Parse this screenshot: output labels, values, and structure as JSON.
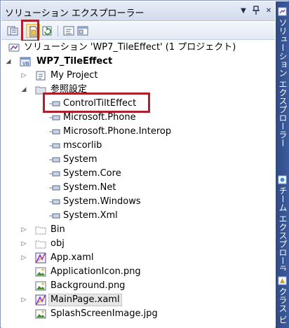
{
  "window": {
    "title": "ソリューション エクスプローラー"
  },
  "title_buttons": {
    "dropdown": "▼",
    "pin": "📌",
    "close": "✕"
  },
  "toolbar": {
    "buttons": [
      "properties-icon",
      "show-all-files-icon",
      "refresh-icon",
      "view-code-icon",
      "view-designer-icon"
    ]
  },
  "tree": {
    "solution": "ソリューション 'WP7_TileEffect' (1 プロジェクト)",
    "project": "WP7_TileEffect",
    "my_project": "My Project",
    "references": "参照設定",
    "ref_items": [
      "ControlTiltEffect",
      "Microsoft.Phone",
      "Microsoft.Phone.Interop",
      "mscorlib",
      "System",
      "System.Core",
      "System.Net",
      "System.Windows",
      "System.Xml"
    ],
    "folders": [
      "Bin",
      "obj"
    ],
    "files": [
      "App.xaml",
      "ApplicationIcon.png",
      "Background.png",
      "MainPage.xaml",
      "SplashScreenImage.jpg"
    ],
    "selected_item": "MainPage.xaml"
  },
  "side_tabs": [
    "ソリューション エクスプローラー",
    "チーム エクスプローラー",
    "クラス ビ"
  ],
  "colors": {
    "highlight": "#b0202a",
    "side_bg": "#2e4b86",
    "title_bg": "#dbe3f1"
  }
}
